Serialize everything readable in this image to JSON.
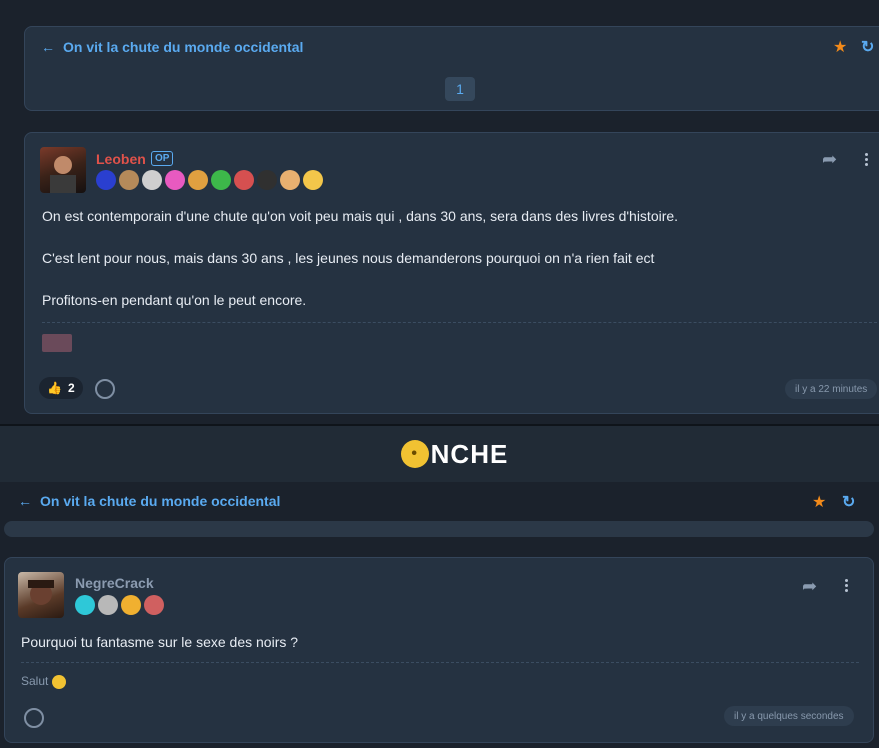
{
  "topic": {
    "title": "On vit la chute du monde occidental"
  },
  "pagination": {
    "current": "1"
  },
  "post1": {
    "username": "Leoben",
    "op_label": "OP",
    "lines": [
      "On est contemporain d'une chute qu'on voit peu mais qui , dans 30 ans, sera dans des livres d'histoire.",
      "C'est lent pour nous, mais dans 30 ans , les jeunes nous demanderons pourquoi on n'a rien fait ect",
      "Profitons-en pendant qu'on le peut encore."
    ],
    "reaction_count": "2",
    "timestamp": "il y a 22 minutes",
    "badge_colors": [
      "#2a3fd0",
      "#b58a5a",
      "#cfcfcf",
      "#e85ac0",
      "#e0a040",
      "#3db84a",
      "#d65050",
      "#303030",
      "#e8b070",
      "#f3c64a"
    ]
  },
  "logo": {
    "text": "NCHE"
  },
  "post2": {
    "username": "NegreCrack",
    "text": "Pourquoi tu fantasme sur le sexe des noirs ?",
    "signature": "Salut",
    "timestamp": "il y a quelques secondes",
    "badge_colors": [
      "#2ec8d8",
      "#b8b8b8",
      "#f0b030",
      "#d06060"
    ]
  },
  "colors": {
    "accent": "#5aaaf0",
    "star": "#f28a1a",
    "username_red": "#e0524a",
    "username_gray": "#8b9bb0"
  }
}
